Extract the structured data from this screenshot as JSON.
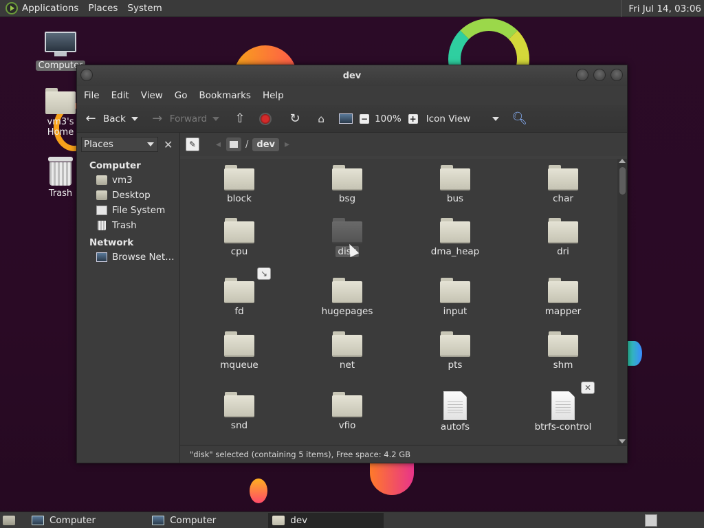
{
  "top_panel": {
    "menus": [
      "Applications",
      "Places",
      "System"
    ],
    "clock": "Fri Jul 14, 03:06"
  },
  "desktop": {
    "icons": [
      {
        "label": "Computer",
        "icon": "computer-icon"
      },
      {
        "label": "vm3's Home",
        "icon": "home-folder-icon"
      },
      {
        "label": "Trash",
        "icon": "trash-icon"
      }
    ]
  },
  "window": {
    "title": "dev",
    "menu": [
      "File",
      "Edit",
      "View",
      "Go",
      "Bookmarks",
      "Help"
    ],
    "toolbar": {
      "back": "Back",
      "forward": "Forward",
      "zoom": "100%",
      "view_mode": "Icon View"
    },
    "sidebar": {
      "selector": "Places",
      "sections": [
        {
          "title": "Computer",
          "items": [
            {
              "label": "vm3",
              "icon": "home-icon"
            },
            {
              "label": "Desktop",
              "icon": "desktop-icon"
            },
            {
              "label": "File System",
              "icon": "drive-icon"
            },
            {
              "label": "Trash",
              "icon": "trash-icon"
            }
          ]
        },
        {
          "title": "Network",
          "items": [
            {
              "label": "Browse Net…",
              "icon": "network-icon"
            }
          ]
        }
      ]
    },
    "path": {
      "current": "dev",
      "separator": "/"
    },
    "items": [
      {
        "name": "block",
        "type": "folder"
      },
      {
        "name": "bsg",
        "type": "folder"
      },
      {
        "name": "bus",
        "type": "folder"
      },
      {
        "name": "char",
        "type": "folder"
      },
      {
        "name": "cpu",
        "type": "folder"
      },
      {
        "name": "disk",
        "type": "folder",
        "selected": true
      },
      {
        "name": "dma_heap",
        "type": "folder"
      },
      {
        "name": "dri",
        "type": "folder"
      },
      {
        "name": "fd",
        "type": "folder",
        "emblem": "symlink"
      },
      {
        "name": "hugepages",
        "type": "folder"
      },
      {
        "name": "input",
        "type": "folder"
      },
      {
        "name": "mapper",
        "type": "folder"
      },
      {
        "name": "mqueue",
        "type": "folder"
      },
      {
        "name": "net",
        "type": "folder"
      },
      {
        "name": "pts",
        "type": "folder"
      },
      {
        "name": "shm",
        "type": "folder"
      },
      {
        "name": "snd",
        "type": "folder"
      },
      {
        "name": "vfio",
        "type": "folder"
      },
      {
        "name": "autofs",
        "type": "file"
      },
      {
        "name": "btrfs-control",
        "type": "file",
        "emblem": "no-access"
      }
    ],
    "status": "\"disk\" selected (containing 5 items), Free space: 4.2 GB"
  },
  "taskbar": {
    "tasks": [
      {
        "label": "Computer",
        "icon": "computer-icon",
        "active": false
      },
      {
        "label": "Computer",
        "icon": "computer-icon",
        "active": false
      },
      {
        "label": "dev",
        "icon": "folder-icon",
        "active": true
      }
    ]
  }
}
